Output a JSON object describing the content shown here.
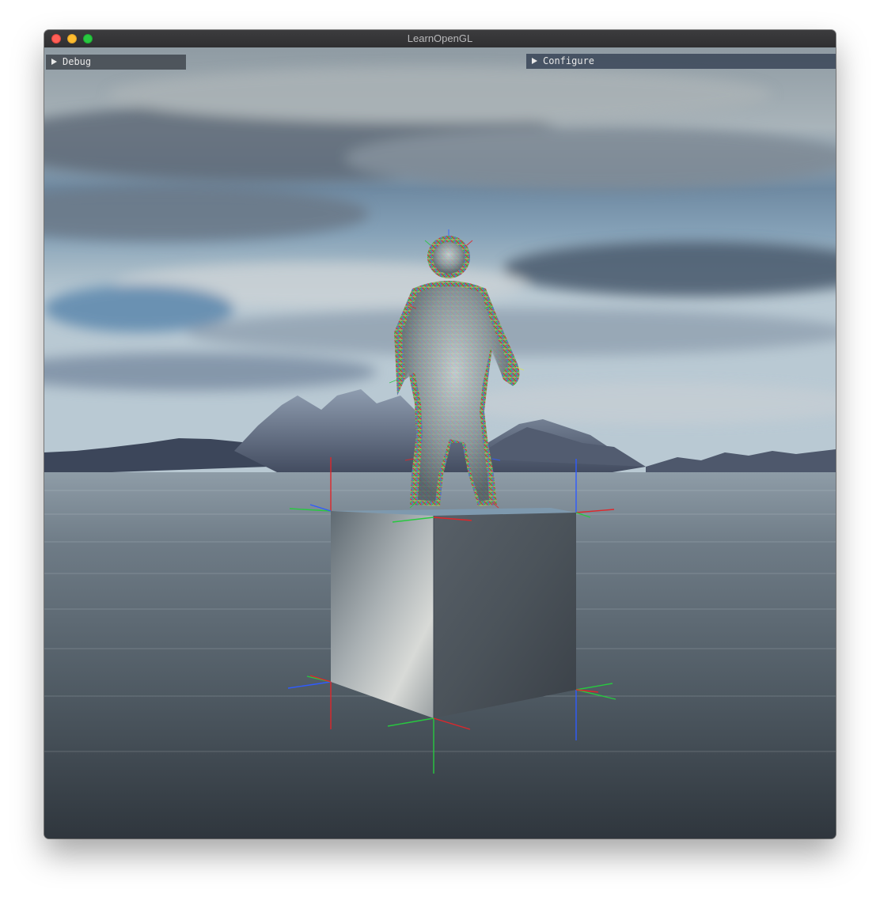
{
  "window": {
    "title": "LearnOpenGL"
  },
  "panels": {
    "debug": {
      "label": "Debug",
      "collapsed": true
    },
    "configure": {
      "label": "Configure",
      "collapsed": true
    }
  },
  "colors": {
    "close": "#ff5f57",
    "minimize": "#febc2e",
    "maximize": "#28c840",
    "axis_x": "#e0262a",
    "axis_y": "#27c93f",
    "axis_z": "#2f5bff"
  }
}
